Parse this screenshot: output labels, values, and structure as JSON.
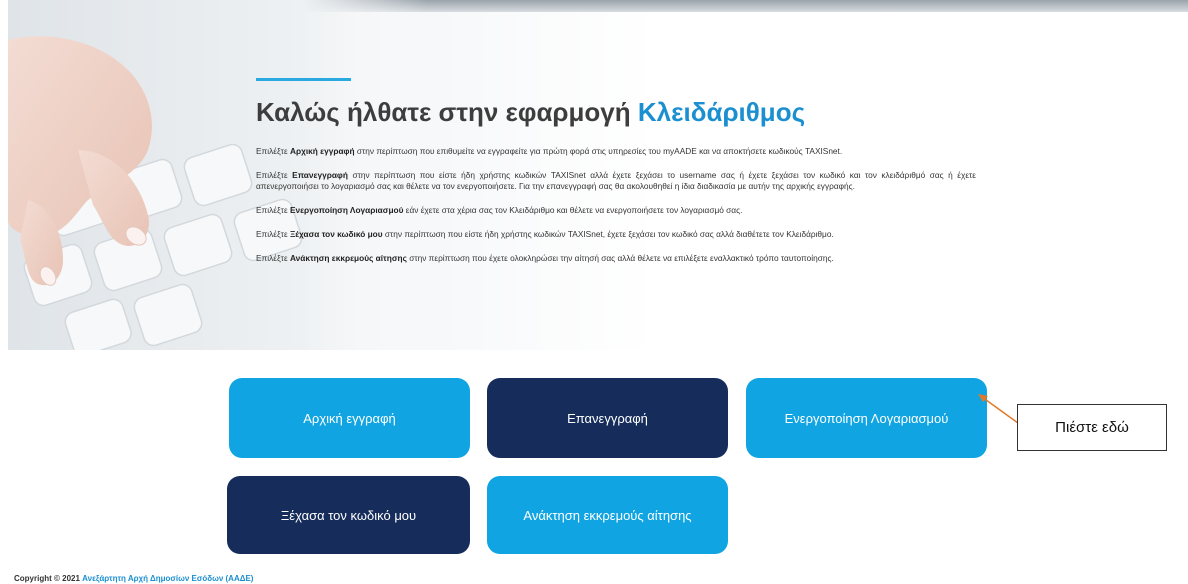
{
  "hero": {
    "title_prefix": "Καλώς ήλθατε στην εφαρμογή",
    "title_accent": "Κλειδάριθμος",
    "paragraphs": [
      {
        "pre": "Επιλέξτε ",
        "bold": "Αρχική εγγραφή",
        "post": " στην περίπτωση που επιθυμείτε να εγγραφείτε για πρώτη φορά στις υπηρεσίες του myAADE και να αποκτήσετε κωδικούς TAXISnet."
      },
      {
        "pre": "Επιλέξτε ",
        "bold": "Επανεγγραφή",
        "post": " στην περίπτωση που είστε ήδη χρήστης κωδικών TAXISnet αλλά έχετε ξεχάσει το username σας ή έχετε ξεχάσει τον κωδικό και τον κλειδάριθμό σας ή έχετε απενεργοποιήσει το λογαριασμό σας και θέλετε να τον ενεργοποιήσετε. Για την επανεγγραφή σας θα ακολουθηθεί η ίδια διαδικασία με αυτήν της αρχικής εγγραφής."
      },
      {
        "pre": "Επιλέξτε ",
        "bold": "Ενεργοποίηση Λογαριασμού",
        "post": " εάν έχετε στα χέρια σας τον Κλειδάριθμο και θέλετε να ενεργοποιήσετε τον λογαριασμό σας."
      },
      {
        "pre": "Επιλέξτε ",
        "bold": "Ξέχασα τον κωδικό μου",
        "post": " στην περίπτωση που είστε ήδη χρήστης κωδικών TAXISnet, έχετε ξεχάσει τον κωδικό σας αλλά διαθέτετε τον Κλειδάριθμο."
      },
      {
        "pre": "Επιλέξτε ",
        "bold": "Ανάκτηση εκκρεμούς αίτησης",
        "post": " στην περίπτωση που έχετε ολοκληρώσει την αίτησή σας αλλά θέλετε να επιλέξετε εναλλακτικό τρόπο ταυτοποίησης."
      }
    ]
  },
  "buttons": {
    "initial_registration": "Αρχική εγγραφή",
    "re_registration": "Επανεγγραφή",
    "account_activation": "Ενεργοποίηση Λογαριασμού",
    "forgot_password": "Ξέχασα τον κωδικό μου",
    "recover_pending": "Ανάκτηση εκκρεμούς αίτησης"
  },
  "callout": {
    "text": "Πιέστε εδώ"
  },
  "footer": {
    "copyright": "Copyright © 2021",
    "org_link": "Ανεξάρτητη Αρχή Δημοσίων Εσόδων (ΑΑΔΕ)"
  },
  "colors": {
    "accent": "#1b8fd0",
    "button_light": "#10a5e2",
    "button_dark": "#162d5c"
  },
  "icons": {
    "hero_image": "hand-on-keyboard-illustration",
    "callout_arrow": "arrow-pointer-icon"
  }
}
